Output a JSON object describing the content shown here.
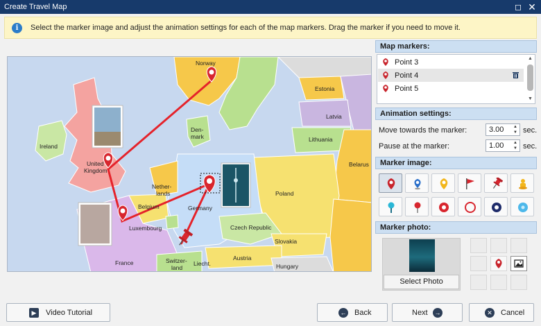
{
  "window": {
    "title": "Create Travel Map",
    "maximize_icon": "maximize-icon",
    "close_icon": "close-icon"
  },
  "info": {
    "icon": "info-icon",
    "text": "Select the marker image and adjust the animation settings for each of the map markers. Drag the marker if you need to move it."
  },
  "map": {
    "labels": {
      "norway": "Norway",
      "estonia": "Estonia",
      "latvia": "Latvia",
      "lithuania": "Lithuania",
      "denmark": "Den-\nmark",
      "ireland": "Ireland",
      "uk": "United\nKingdom",
      "belarus": "Belarus",
      "netherlands": "Nether-\nlands",
      "belgium": "Belgium",
      "germany": "Germany",
      "poland": "Poland",
      "luxembourg": "Luxembourg",
      "czech": "Czech Republic",
      "slovakia": "Slovakia",
      "france": "France",
      "austria": "Austria",
      "hungary": "Hungary",
      "switzerland": "Switzer-\nland",
      "liechtenstein": "Liecht."
    }
  },
  "panel": {
    "map_markers_header": "Map markers:",
    "markers": [
      {
        "label": "Point 3",
        "selected": false
      },
      {
        "label": "Point 4",
        "selected": true
      },
      {
        "label": "Point 5",
        "selected": false
      }
    ],
    "animation_header": "Animation settings:",
    "move_label": "Move towards the marker:",
    "move_value": "3.00",
    "pause_label": "Pause at the marker:",
    "pause_value": "1.00",
    "unit": "sec.",
    "marker_image_header": "Marker image:",
    "marker_images": [
      "red-pin-icon",
      "blue-pin-icon",
      "yellow-pin-icon",
      "red-flag-icon",
      "pushpin-icon",
      "yellow-figure-icon",
      "teal-pin-icon",
      "red-tack-icon",
      "red-ring-icon",
      "red-circle-icon",
      "navy-ring-icon",
      "blue-dot-icon"
    ],
    "selected_marker_image": 0,
    "marker_photo_header": "Marker photo:",
    "select_photo_label": "Select Photo",
    "photo_position_selected": "right"
  },
  "footer": {
    "video_tutorial": "Video Tutorial",
    "back": "Back",
    "next": "Next",
    "cancel": "Cancel"
  },
  "colors": {
    "route": "#e5222a",
    "marker": "#d8262e",
    "titlebar": "#173a6b",
    "accent": "#2b7cc9"
  }
}
